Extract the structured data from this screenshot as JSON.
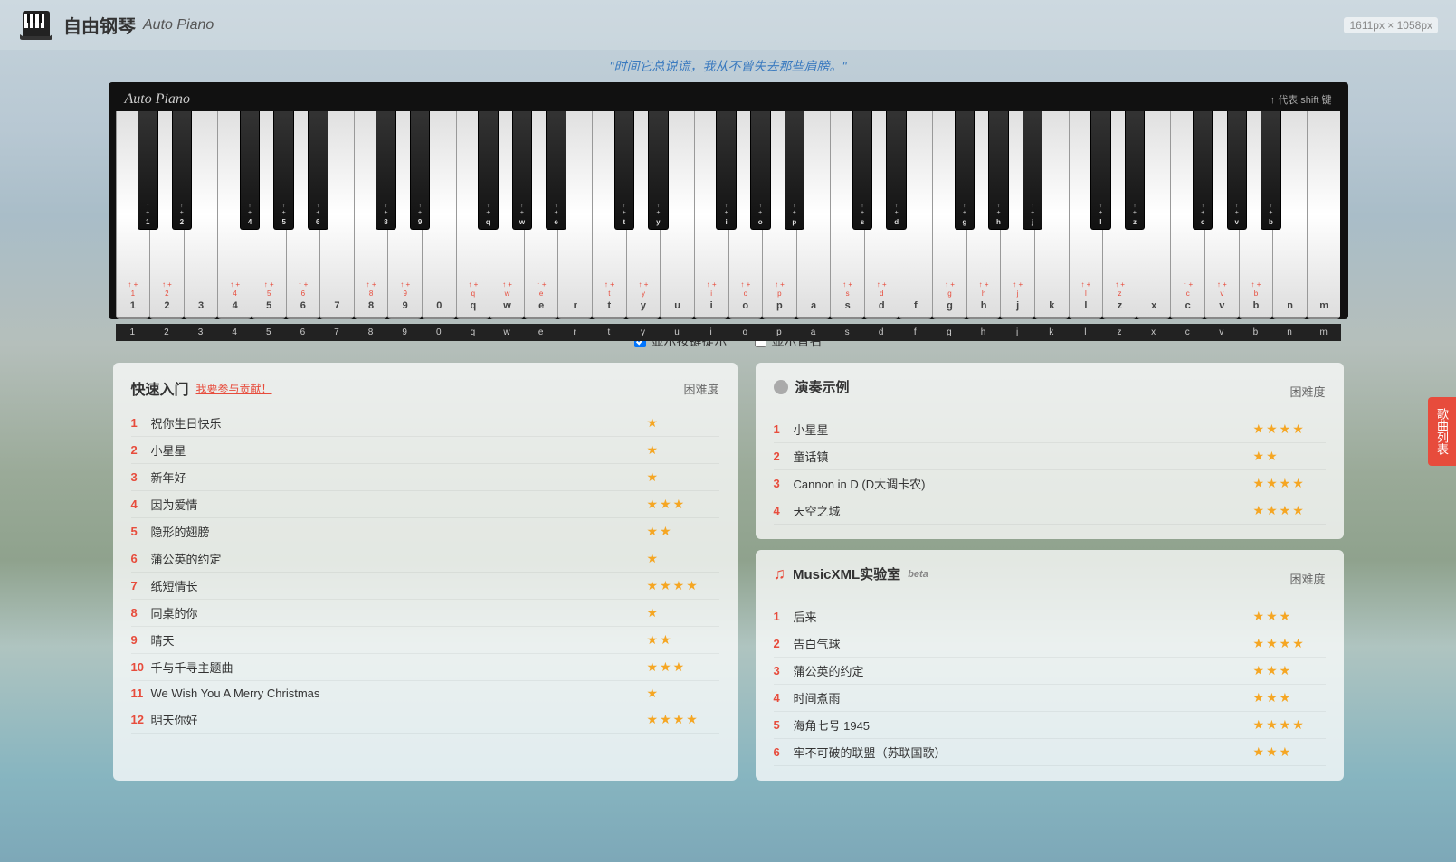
{
  "app": {
    "title": "自由钢琴",
    "subtitle": "Auto Piano",
    "logo_alt": "piano-logo",
    "dim_text": "1611px × 1058px"
  },
  "quote": "\"时间它总说谎，我从不曾失去那些肩膀。\"",
  "piano": {
    "brand": "Auto Piano",
    "shift_hint": "↑ 代表 shift 键",
    "show_hints_label": "显示按键提示",
    "show_note_names_label": "显示音名",
    "show_hints_checked": true,
    "show_note_names_checked": false
  },
  "quick_start": {
    "title": "快速入门",
    "contribute_label": "我要参与贡献！",
    "difficulty_header": "困难度",
    "songs": [
      {
        "num": 1,
        "name": "祝你生日快乐",
        "stars": 1
      },
      {
        "num": 2,
        "name": "小星星",
        "stars": 1
      },
      {
        "num": 3,
        "name": "新年好",
        "stars": 1
      },
      {
        "num": 4,
        "name": "因为爱情",
        "stars": 3
      },
      {
        "num": 5,
        "name": "隐形的翅膀",
        "stars": 2
      },
      {
        "num": 6,
        "name": "蒲公英的约定",
        "stars": 1
      },
      {
        "num": 7,
        "name": "纸短情长",
        "stars": 4
      },
      {
        "num": 8,
        "name": "同桌的你",
        "stars": 1
      },
      {
        "num": 9,
        "name": "晴天",
        "stars": 2
      },
      {
        "num": 10,
        "name": "千与千寻主题曲",
        "stars": 3
      },
      {
        "num": 11,
        "name": "We Wish You A Merry Christmas",
        "stars": 1
      },
      {
        "num": 12,
        "name": "明天你好",
        "stars": 4
      }
    ]
  },
  "performance": {
    "title": "演奏示例",
    "difficulty_header": "困难度",
    "songs": [
      {
        "num": 1,
        "name": "小星星",
        "stars": 4
      },
      {
        "num": 2,
        "name": "童话镇",
        "stars": 2
      },
      {
        "num": 3,
        "name": "Cannon in D (D大调卡农)",
        "stars": 4
      },
      {
        "num": 4,
        "name": "天空之城",
        "stars": 4
      }
    ]
  },
  "musicxml": {
    "title": "MusicXML实验室",
    "beta_label": "beta",
    "difficulty_header": "困难度",
    "songs": [
      {
        "num": 1,
        "name": "后来",
        "stars": 3
      },
      {
        "num": 2,
        "name": "告白气球",
        "stars": 4
      },
      {
        "num": 3,
        "name": "蒲公英的约定",
        "stars": 3
      },
      {
        "num": 4,
        "name": "时间煮雨",
        "stars": 3
      },
      {
        "num": 5,
        "name": "海角七号 1945",
        "stars": 4
      },
      {
        "num": 6,
        "name": "牢不可破的联盟（苏联国歌）",
        "stars": 3
      }
    ]
  },
  "side_tab": {
    "label": "歌曲列表"
  },
  "piano_keys": {
    "white_keys": [
      "1",
      "2",
      "3",
      "4",
      "5",
      "6",
      "7",
      "8",
      "9",
      "0",
      "q",
      "w",
      "e",
      "r",
      "t",
      "y",
      "u",
      "i",
      "o",
      "p",
      "a",
      "s",
      "d",
      "f",
      "g",
      "h",
      "j",
      "k",
      "l",
      "z",
      "x",
      "c",
      "v",
      "b",
      "n",
      "m"
    ],
    "shift_keys": [
      "1",
      "2",
      "",
      "4",
      "5",
      "6",
      "",
      "8",
      "9",
      "",
      "q",
      "w",
      "e",
      "",
      "t",
      "y",
      "",
      "i",
      "o",
      "p",
      "",
      "s",
      "d",
      "",
      "g",
      "h",
      "j",
      "",
      "l",
      "z",
      "",
      "c",
      "v",
      "b",
      "",
      ""
    ]
  }
}
